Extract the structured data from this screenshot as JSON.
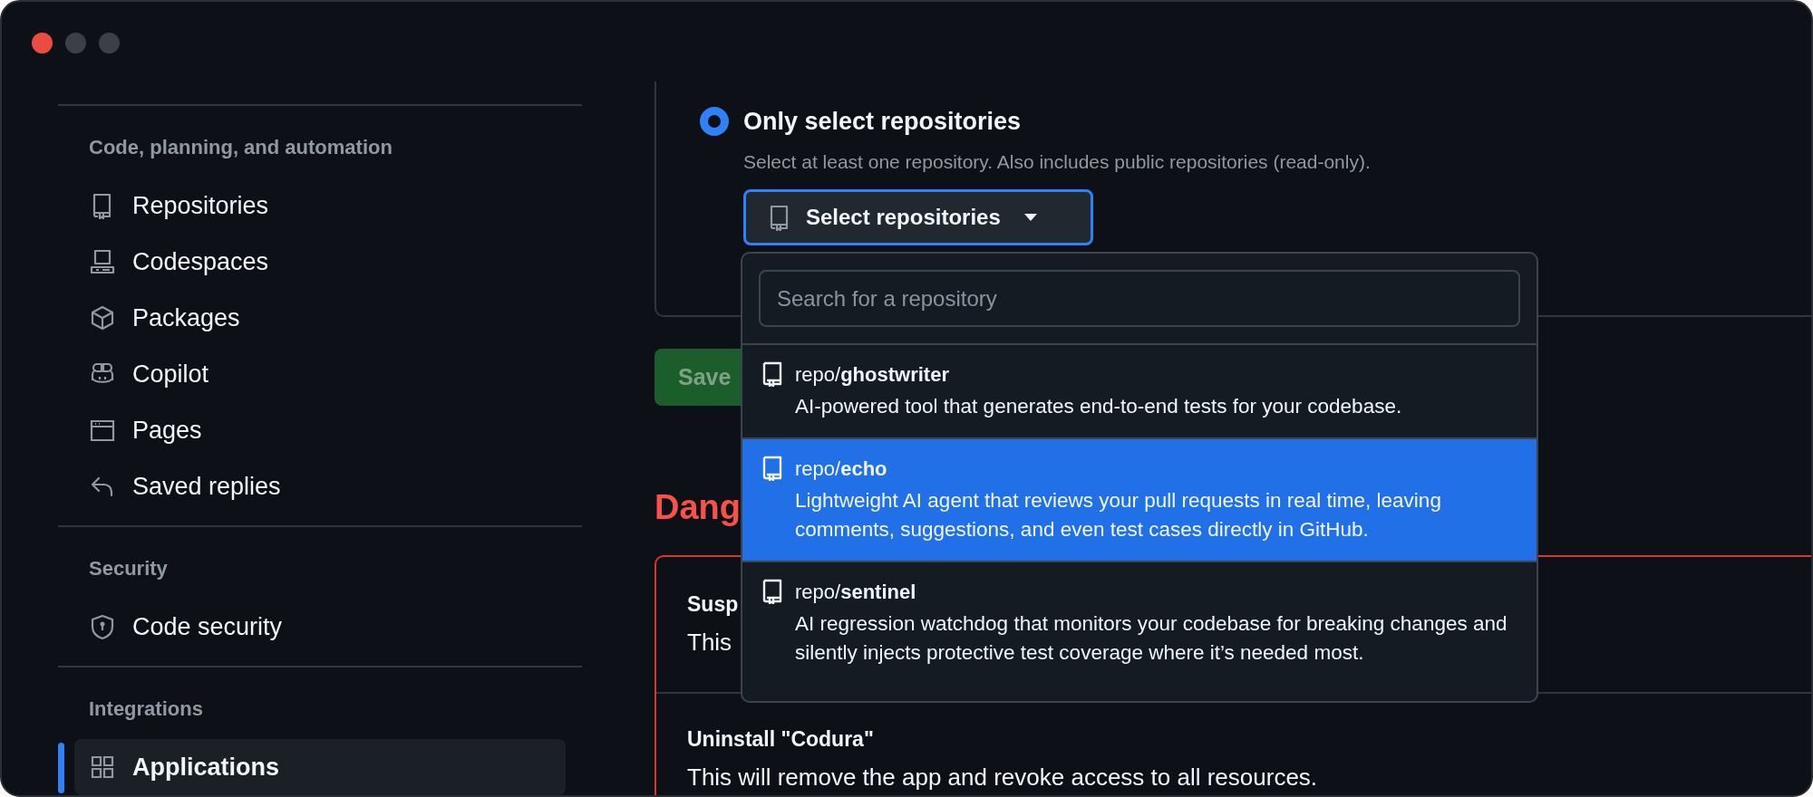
{
  "sidebar": {
    "sections": [
      {
        "heading": "Code, planning, and automation",
        "items": [
          {
            "label": "Repositories",
            "kind": "repo",
            "selected": false
          },
          {
            "label": "Codespaces",
            "kind": "codespaces",
            "selected": false
          },
          {
            "label": "Packages",
            "kind": "package",
            "selected": false
          },
          {
            "label": "Copilot",
            "kind": "copilot",
            "selected": false
          },
          {
            "label": "Pages",
            "kind": "pages",
            "selected": false
          },
          {
            "label": "Saved replies",
            "kind": "reply",
            "selected": false
          }
        ]
      },
      {
        "heading": "Security",
        "items": [
          {
            "label": "Code security",
            "kind": "shield",
            "selected": false
          }
        ]
      },
      {
        "heading": "Integrations",
        "items": [
          {
            "label": "Applications",
            "kind": "apps",
            "selected": true
          }
        ]
      }
    ]
  },
  "access_option": {
    "label": "Only select repositories",
    "description": "Select at least one repository. Also includes public repositories (read-only).",
    "selected": true
  },
  "repo_button": {
    "label": "Select repositories"
  },
  "save_button": {
    "label": "Save",
    "disabled": true
  },
  "danger_zone": {
    "heading": "Dang",
    "rows": [
      {
        "title": "Susp",
        "description": "This"
      },
      {
        "title": "Uninstall \"Codura\"",
        "description": "This will remove the app and revoke access to all resources."
      }
    ]
  },
  "repo_menu": {
    "search": {
      "placeholder": "Search for a repository"
    },
    "items": [
      {
        "name": "repo/**ghostwriter**",
        "description": "AI-powered tool that generates end-to-end tests for your codebase.",
        "selected": false
      },
      {
        "name": "repo/**echo**",
        "description": "Lightweight AI agent that reviews your pull requests in real time, leaving comments, suggestions, and even test cases directly in GitHub.",
        "selected": true
      },
      {
        "name": "repo/**sentinel**",
        "description": "AI regression watchdog that monitors your codebase for breaking changes and silently injects protective test coverage where it’s needed most.",
        "selected": false
      }
    ]
  }
}
